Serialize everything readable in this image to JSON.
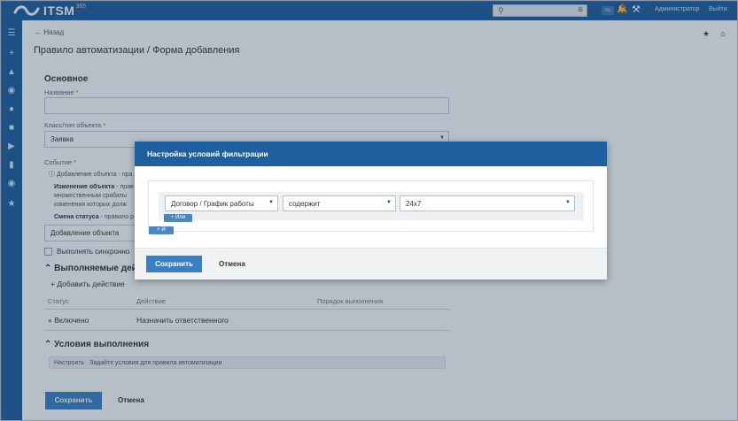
{
  "topbar": {
    "logo_text": "ITSM",
    "logo_sup": "365",
    "search_placeholder": "",
    "lang": "ru",
    "user_link": "Администратор",
    "logout_link": "Выйти",
    "bg_color": "#1e5fa0"
  },
  "sidebar": {
    "icons": [
      "menu-icon",
      "plus-icon",
      "org-icon",
      "eye-icon",
      "users-icon",
      "book-icon",
      "megaphone-icon",
      "chart-icon",
      "user-circle-icon",
      "star-icon"
    ]
  },
  "header": {
    "back_label": "Назад",
    "title": "Правило автоматизации / Форма добавления"
  },
  "form": {
    "section_main": "Основное",
    "name_label": "Название",
    "name_value": "",
    "class_label": "Класс/тип объекта",
    "class_value": "Заявка",
    "event_label": "Событие",
    "event_option_1": "Добавление объекта - пра",
    "event_option_2_bold": "Изменение объекта",
    "event_option_2_text": " - прав",
    "event_option_2_line2": "множественным срабаты",
    "event_option_2_line3": "изменения которых долж",
    "event_option_3_bold": "Смена статуса",
    "event_option_3_text": " - правило р",
    "event_value": "Добавление объекта",
    "sync_label": "Выполнять синхронно",
    "actions_section": "Выполняемые дей",
    "add_action": "Добавить действие",
    "table_headers": [
      "Статус",
      "Действие",
      "Порядок выполнения"
    ],
    "table_rows": [
      {
        "status": "Включено",
        "action": "Назначить ответственного",
        "order": ""
      }
    ],
    "conditions_section": "Условия выполнения",
    "conditions_set": "Настроить",
    "conditions_hint": "Задайте условия для правила автоматизации",
    "save_button": "Сохранить",
    "cancel_button": "Отмена"
  },
  "modal": {
    "title": "Настройка условий фильтрации",
    "field_value": "Договор / График работы",
    "operator_value": "содержит",
    "value_value": "24x7",
    "or_button": "+ Или",
    "and_button": "+ И",
    "save_button": "Сохранить",
    "cancel_button": "Отмена"
  }
}
